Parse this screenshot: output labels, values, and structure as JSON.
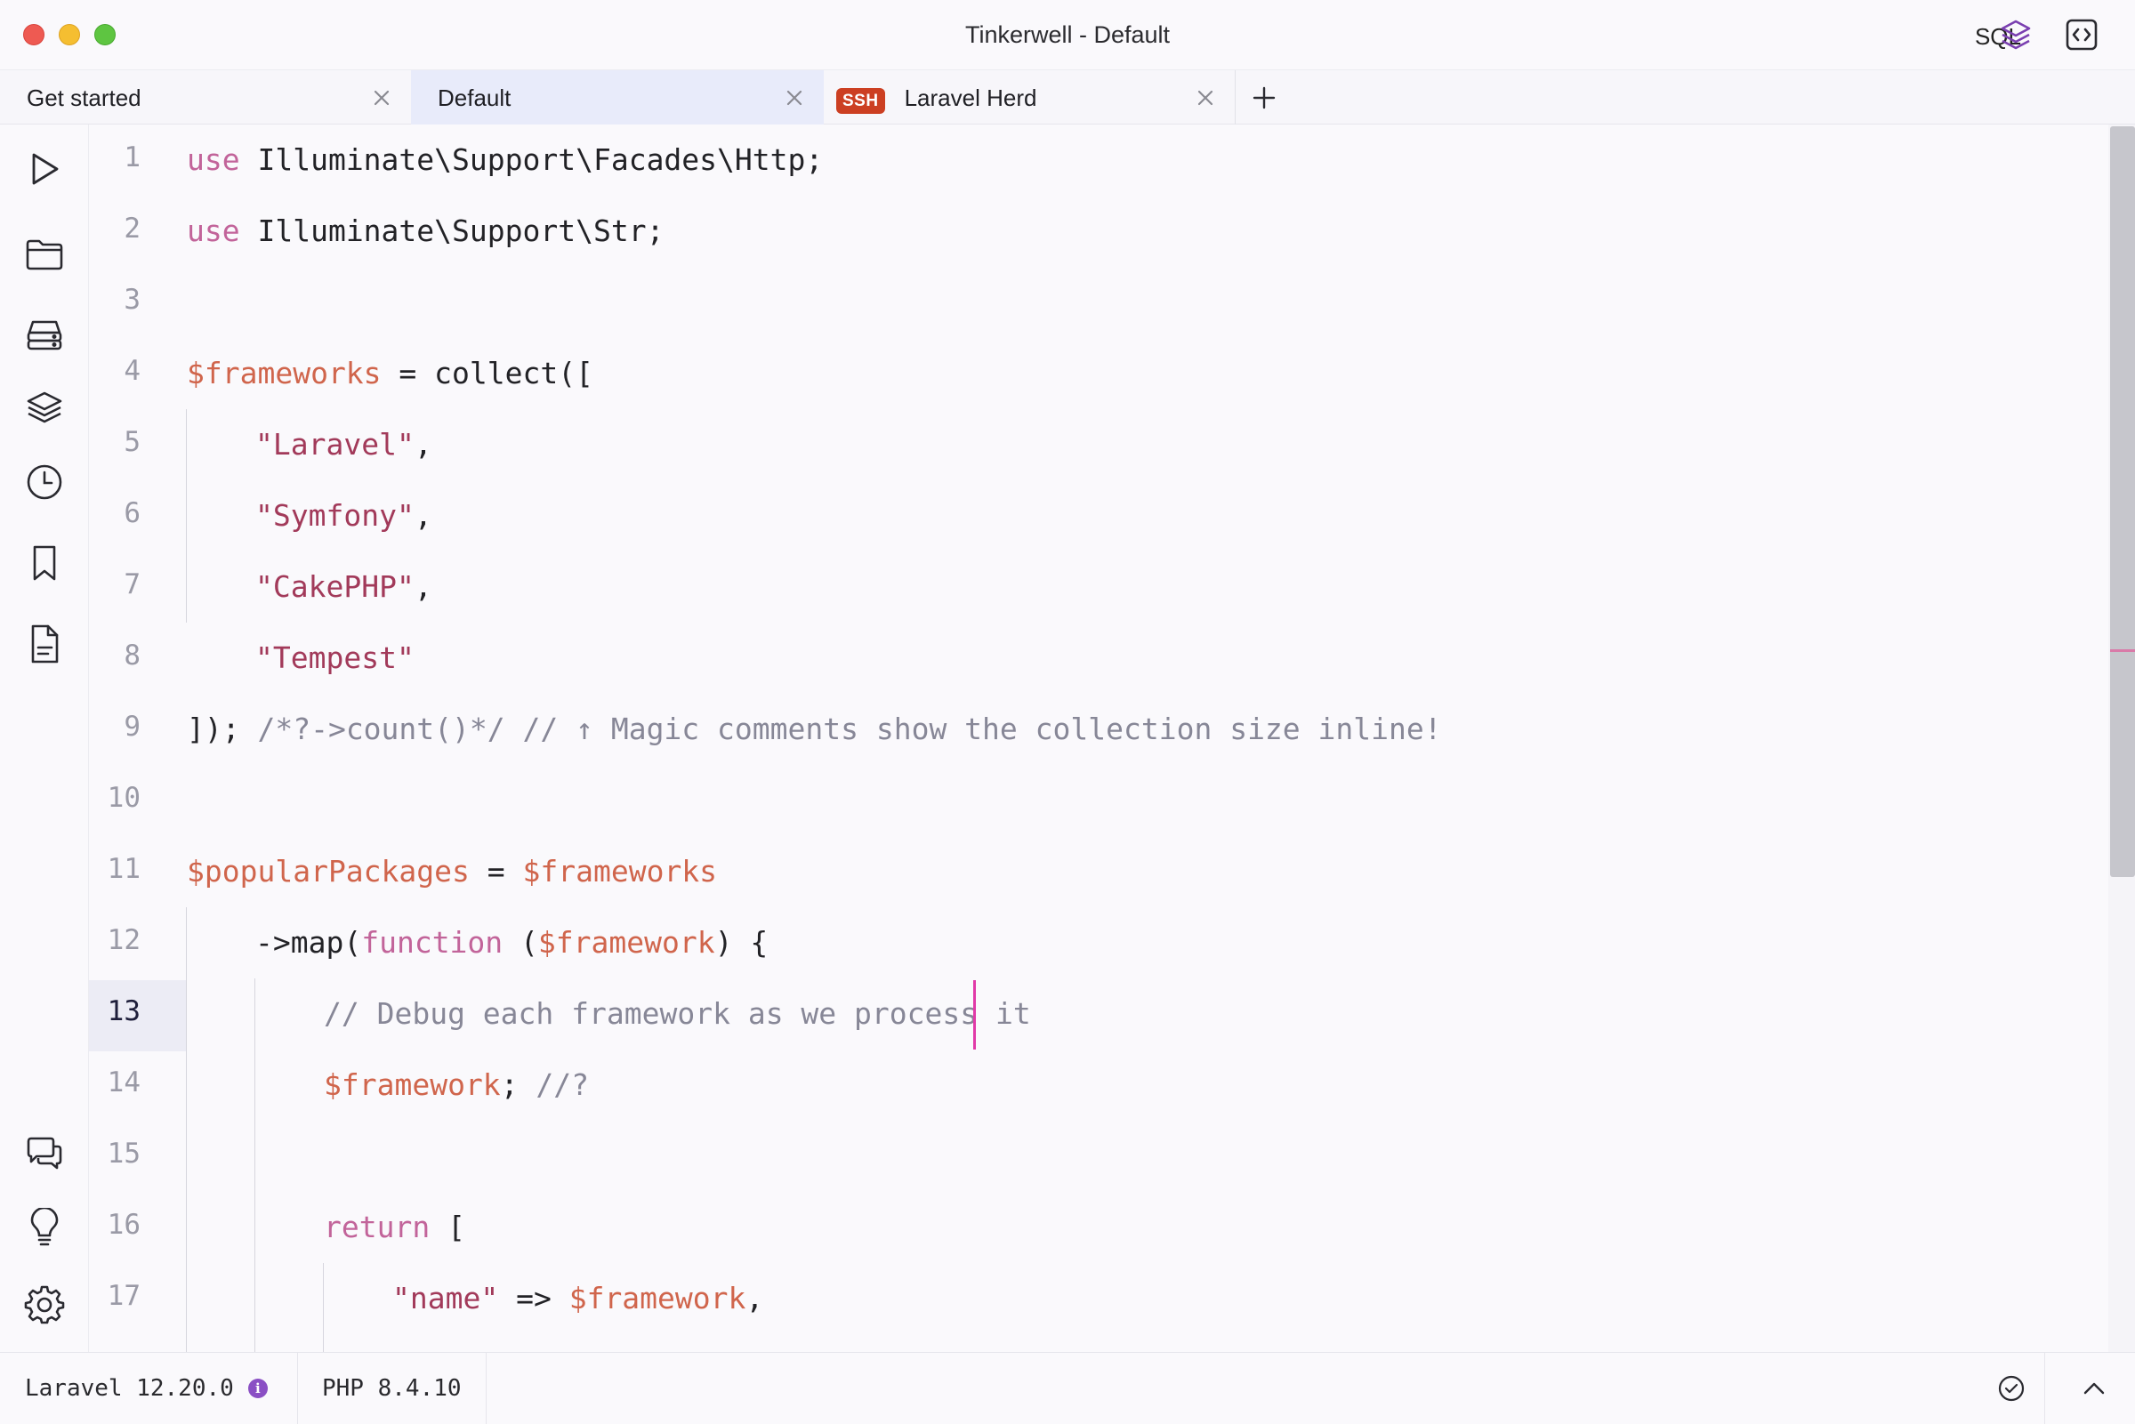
{
  "window": {
    "title": "Tinkerwell - Default",
    "sql_label": "SQL",
    "accent": "#7a3fb0"
  },
  "tabs": [
    {
      "label": "Get started",
      "active": false
    },
    {
      "label": "Default",
      "active": true
    },
    {
      "label": "Laravel Herd",
      "badge": "SSH",
      "active": false
    }
  ],
  "sidebar": {
    "top_icons": [
      "play-icon",
      "folder-icon",
      "database-icon",
      "layers-icon",
      "clock-icon",
      "bookmark-icon",
      "document-icon"
    ],
    "bottom_icons": [
      "chat-icon",
      "lightbulb-icon",
      "gear-icon"
    ]
  },
  "editor": {
    "current_line": 13,
    "line_numbers": [
      "1",
      "2",
      "3",
      "4",
      "5",
      "6",
      "7",
      "8",
      "9",
      "10",
      "11",
      "12",
      "13",
      "14",
      "15",
      "16",
      "17"
    ],
    "lines": {
      "l1_kw": "use",
      "l1_rest": " Illuminate\\Support\\Facades\\Http;",
      "l2_kw": "use",
      "l2_rest": " Illuminate\\Support\\Str;",
      "l4_var": "$frameworks",
      "l4_rest": " = collect([",
      "l5_str": "\"Laravel\"",
      "l5_rest": ",",
      "l6_str": "\"Symfony\"",
      "l6_rest": ",",
      "l7_str": "\"CakePHP\"",
      "l7_rest": ",",
      "l8_str": "\"Tempest\"",
      "l9_code": "]);",
      "l9_cmt": " /*?->count()*/ // ↑ Magic comments show the collection size inline!",
      "l11_var": "$popularPackages",
      "l11_op": " = ",
      "l11_var2": "$frameworks",
      "l12_a": "->map(",
      "l12_kw": "function",
      "l12_b": " (",
      "l12_var": "$framework",
      "l12_c": ") {",
      "l13_cmt": "// Debug each framework as we process it",
      "l14_var": "$framework",
      "l14_rest": ";",
      "l14_cmt": " //?",
      "l16_kw": "return",
      "l16_rest": " [",
      "l17_str": "\"name\"",
      "l17_op": " => ",
      "l17_var": "$framework",
      "l17_rest": ","
    }
  },
  "statusbar": {
    "laravel_version": "Laravel 12.20.0",
    "info_glyph": "i",
    "php_version": "PHP 8.4.10"
  }
}
